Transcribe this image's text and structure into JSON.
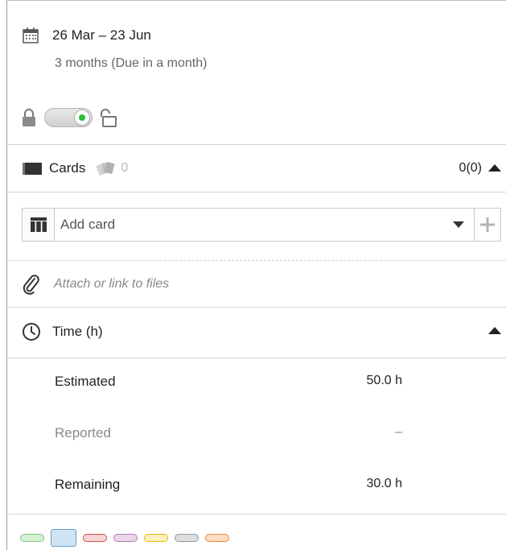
{
  "dates": {
    "range": "26 Mar – 23 Jun",
    "duration": "3 months (Due in a month)"
  },
  "lock_toggle": {
    "state": "on"
  },
  "cards": {
    "label": "Cards",
    "count": "0",
    "total": "0(0)"
  },
  "add_card": {
    "placeholder": "Add card"
  },
  "attach": {
    "label": "Attach or link to files"
  },
  "time": {
    "label": "Time (h)",
    "rows": [
      {
        "label": "Estimated",
        "value": "50.0 h"
      },
      {
        "label": "Reported",
        "value": "–"
      },
      {
        "label": "Remaining",
        "value": "30.0 h"
      }
    ]
  },
  "swatches": [
    {
      "name": "green",
      "fill": "#d6f0d6",
      "border": "#7dc47d"
    },
    {
      "name": "blue",
      "fill": "#cfe3f5",
      "border": "#6a9bc8",
      "selected": true
    },
    {
      "name": "red",
      "fill": "#f7d3d3",
      "border": "#d44b4b"
    },
    {
      "name": "purple",
      "fill": "#ecd6ec",
      "border": "#b07ab0"
    },
    {
      "name": "yellow",
      "fill": "#fbf0c0",
      "border": "#e0b800"
    },
    {
      "name": "gray",
      "fill": "#dedede",
      "border": "#999999"
    },
    {
      "name": "orange",
      "fill": "#fbdcc4",
      "border": "#f08a3a"
    }
  ]
}
